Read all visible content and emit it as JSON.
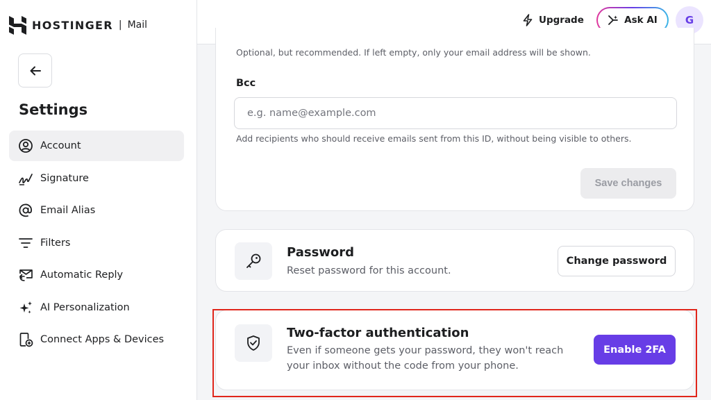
{
  "brand": {
    "name": "HOSTINGER",
    "separator": "|",
    "app": "Mail"
  },
  "sidebar": {
    "title": "Settings",
    "items": [
      {
        "label": "Account",
        "icon": "account-icon",
        "active": true
      },
      {
        "label": "Signature",
        "icon": "signature-icon",
        "active": false
      },
      {
        "label": "Email Alias",
        "icon": "at-icon",
        "active": false
      },
      {
        "label": "Filters",
        "icon": "filter-icon",
        "active": false
      },
      {
        "label": "Automatic Reply",
        "icon": "auto-reply-icon",
        "active": false
      },
      {
        "label": "AI Personalization",
        "icon": "sparkle-icon",
        "active": false
      },
      {
        "label": "Connect Apps & Devices",
        "icon": "connect-device-icon",
        "active": false
      }
    ]
  },
  "topbar": {
    "upgrade_label": "Upgrade",
    "ask_ai_label": "Ask AI",
    "avatar_initial": "G"
  },
  "form": {
    "reply_to_hint": "Optional, but recommended. If left empty, only your email address will be shown.",
    "bcc_label": "Bcc",
    "bcc_placeholder": "e.g. name@example.com",
    "bcc_value": "",
    "bcc_hint": "Add recipients who should receive emails sent from this ID, without being visible to others.",
    "save_label": "Save changes"
  },
  "password": {
    "title": "Password",
    "description": "Reset password for this account.",
    "button_label": "Change password"
  },
  "two_factor": {
    "title": "Two-factor authentication",
    "description_line1": "Even if someone gets your password, they won't reach",
    "description_line2": "your inbox without the code from your phone.",
    "button_label": "Enable 2FA"
  },
  "colors": {
    "accent": "#673de6",
    "highlight": "#e0261b",
    "active_nav": "#f0f0f2"
  }
}
